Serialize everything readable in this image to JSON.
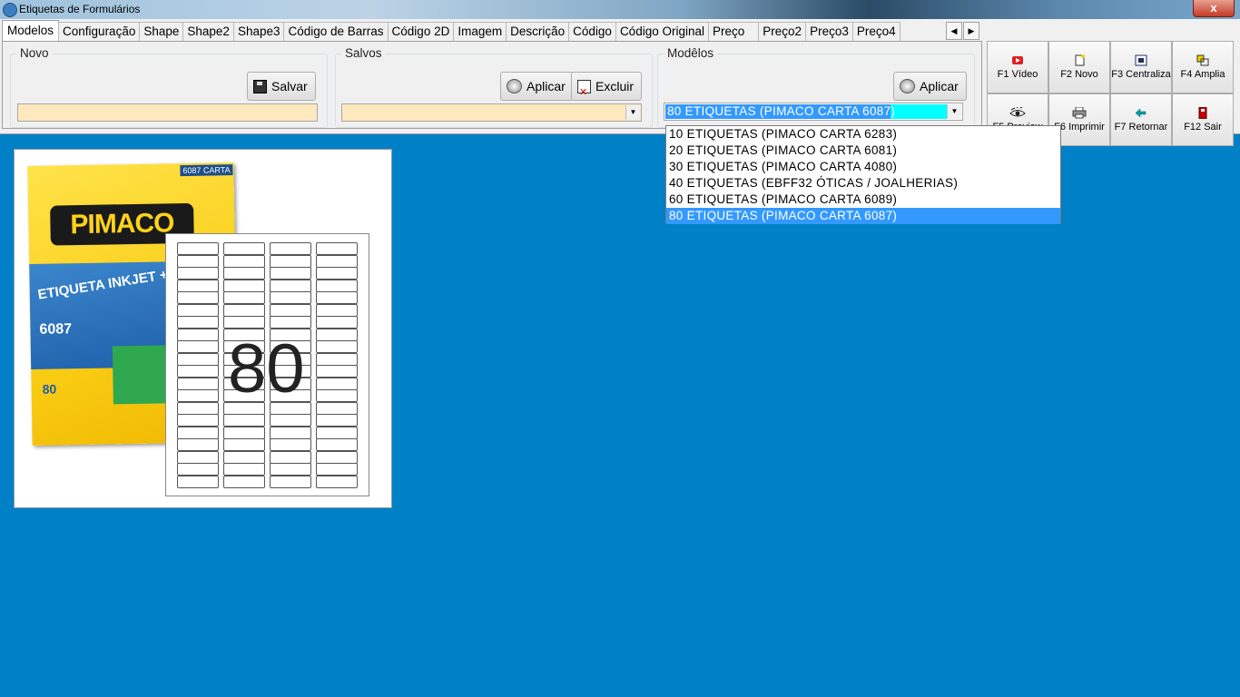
{
  "window": {
    "title": "Etiquetas de Formulários",
    "close_label": "x"
  },
  "tabs": [
    "Modelos",
    "Configuração",
    "Shape",
    "Shape2",
    "Shape3",
    "Código de Barras",
    "Código 2D",
    "Imagem",
    "Descrição",
    "Código",
    "Código Original",
    "Preço",
    "Preço2",
    "Preço3",
    "Preço4"
  ],
  "groups": {
    "novo": {
      "label": "Novo",
      "save_label": "Salvar"
    },
    "salvos": {
      "label": "Salvos",
      "apply_label": "Aplicar",
      "delete_label": "Excluir"
    },
    "modelos": {
      "label": "Modêlos",
      "apply_label": "Aplicar",
      "selected": "80 ETIQUETAS (PIMACO CARTA 6087)"
    }
  },
  "model_options": [
    "10 ETIQUETAS (PIMACO CARTA 6283)",
    "20 ETIQUETAS (PIMACO CARTA 6081)",
    "30 ETIQUETAS (PIMACO CARTA 4080)",
    "40 ETIQUETAS (EBFF32 ÓTICAS / JOALHERIAS)",
    "60 ETIQUETAS (PIMACO CARTA 6089)",
    "80 ETIQUETAS (PIMACO CARTA 6087)"
  ],
  "selected_option_index": 5,
  "function_buttons": [
    {
      "label": "F1 Vídeo",
      "icon": "video-icon",
      "color": "#e02020"
    },
    {
      "label": "F2 Novo",
      "icon": "new-document-icon",
      "color": "#e0c000"
    },
    {
      "label": "F3 Centraliza",
      "icon": "center-icon",
      "color": "#203060"
    },
    {
      "label": "F4 Amplia",
      "icon": "zoom-icon",
      "color": "#d0a000"
    },
    {
      "label": "F5 Preview",
      "icon": "eye-icon",
      "color": "#202020"
    },
    {
      "label": "F6 Imprimir",
      "icon": "printer-icon",
      "color": "#404040"
    },
    {
      "label": "F7 Retornar",
      "icon": "return-arrow-icon",
      "color": "#009999"
    },
    {
      "label": "F12 Sair",
      "icon": "exit-door-icon",
      "color": "#c00000"
    }
  ],
  "preview": {
    "brand": "PIMACO",
    "box_tag": "6087 CARTA",
    "product_line": "ETIQUETA INKJET + LASER",
    "product_code": "6087",
    "labels_per_sheet": "80",
    "label_count": "80"
  }
}
